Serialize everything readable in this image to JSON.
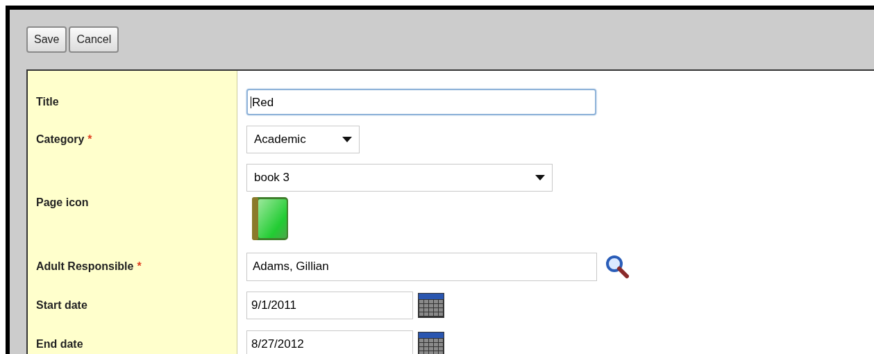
{
  "toolbar": {
    "buttons": [
      "Save",
      "Cancel"
    ]
  },
  "fields": [
    {
      "kind": "text",
      "label": "Title",
      "value": "Red",
      "focused": true
    },
    {
      "kind": "select",
      "label": "Category",
      "required_mark": "*",
      "value": "Academic",
      "focused": false
    },
    {
      "kind": "icon_select",
      "label": "Page icon",
      "value": "book 3",
      "focused": false
    },
    {
      "kind": "lookup",
      "label": "Adult Responsible",
      "required_mark": "*",
      "value": "Adams, Gillian",
      "focused": false
    },
    {
      "kind": "date",
      "label": "Start date",
      "value": "9/1/2011",
      "focused": false
    },
    {
      "kind": "date",
      "label": "End date",
      "value": "8/27/2012",
      "focused": false
    }
  ]
}
